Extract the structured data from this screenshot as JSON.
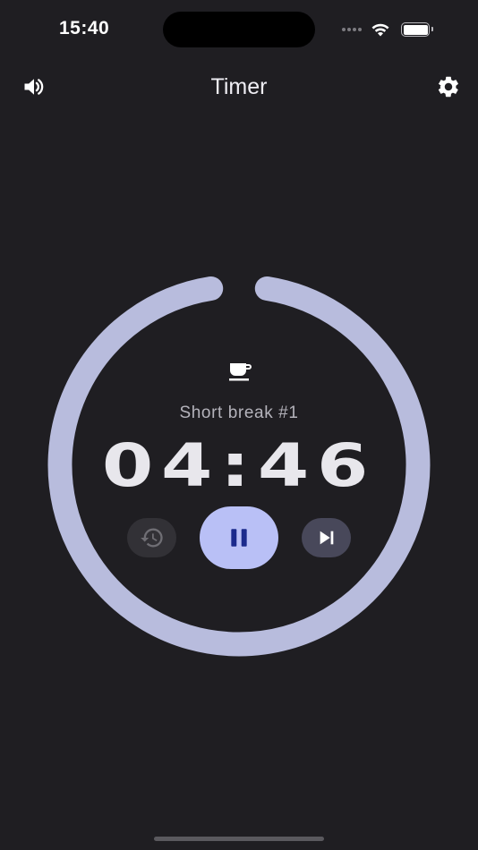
{
  "status_bar": {
    "time": "15:40",
    "icons": [
      "cellular-dots-icon",
      "wifi-icon",
      "battery-icon"
    ]
  },
  "header": {
    "title": "Timer",
    "left_icon": "volume-icon",
    "right_icon": "gear-icon"
  },
  "timer": {
    "mode_icon": "coffee-cup-icon",
    "mode_label": "Short break #1",
    "time_remaining": "04:46",
    "progress_remaining_fraction": 0.95,
    "controls": {
      "reset_icon": "history-icon",
      "pause_icon": "pause-icon",
      "skip_icon": "skip-next-icon"
    }
  },
  "colors": {
    "background": "#1f1e22",
    "ring": "#b8bcdd",
    "accent": "#b9c0f6",
    "accent_icon": "#1b2a8c",
    "reset_bg": "#323136",
    "skip_bg": "#48485a"
  }
}
